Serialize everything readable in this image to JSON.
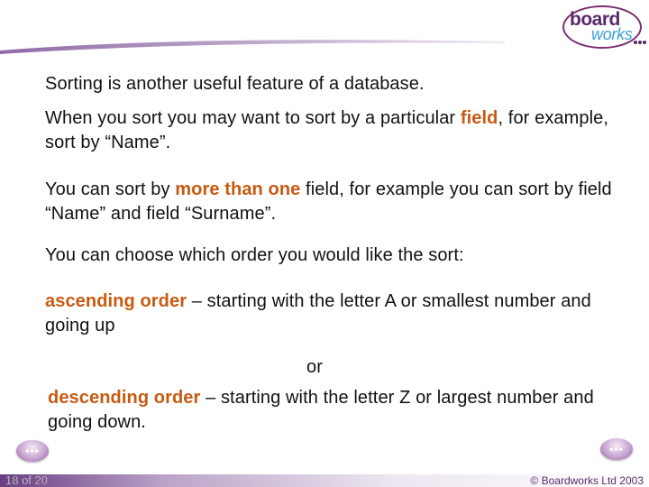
{
  "logo": {
    "word1": "board",
    "word2": "works"
  },
  "content": {
    "p1": "Sorting is another useful feature of a database.",
    "p2_pre": "When you sort you may want to sort by a particular ",
    "p2_hl": "field",
    "p2_post": ", for example, sort by “Name”.",
    "p3_pre": "You can sort by ",
    "p3_hl": "more than one",
    "p3_post": " field, for example you can sort by field “Name” and field “Surname”.",
    "p4": "You can choose which order you would like the sort:",
    "p5_hl": "ascending order",
    "p5_post": " – starting with the letter A or smallest number and going up",
    "p6": "or",
    "p7_hl": "descending order",
    "p7_post": " – starting with the letter Z or largest number and going down."
  },
  "nav": {
    "prev_icon": "ellipsis-icon",
    "next_icon": "ellipsis-icon",
    "dots": "•••"
  },
  "footer": {
    "page": "18 of 20",
    "copyright": "© Boardworks Ltd 2003"
  },
  "colors": {
    "highlight": "#c85a10",
    "brand_purple": "#5b2a6e",
    "brand_blue": "#3aa0d8"
  }
}
